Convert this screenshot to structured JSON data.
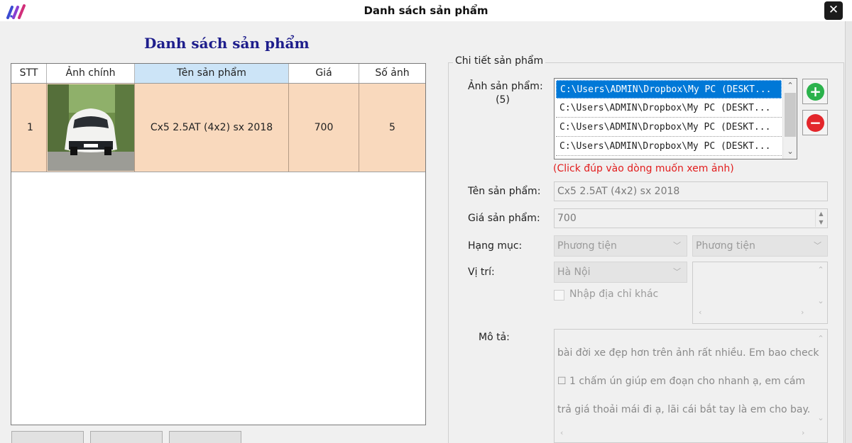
{
  "window": {
    "title": "Danh sách sản phẩm",
    "close_glyph": "✕",
    "logo_icon": "app-logo-icon"
  },
  "list": {
    "heading": "Danh sách sản phẩm",
    "columns": [
      "STT",
      "Ảnh chính",
      "Tên sản phẩm",
      "Giá",
      "Số ảnh"
    ],
    "selected_column": "Tên sản phẩm",
    "rows": [
      {
        "stt": "1",
        "image": "white-suv-photo",
        "name": "Cx5 2.5AT (4x2) sx 2018",
        "price": "700",
        "count": "5"
      }
    ]
  },
  "detail": {
    "group_title": "Chi tiết sản phẩm",
    "images_label": "Ảnh sản phẩm:",
    "images_count": "(5)",
    "images": [
      "C:\\Users\\ADMIN\\Dropbox\\My PC (DESKT...",
      "C:\\Users\\ADMIN\\Dropbox\\My PC (DESKT...",
      "C:\\Users\\ADMIN\\Dropbox\\My PC (DESKT...",
      "C:\\Users\\ADMIN\\Dropbox\\My PC (DESKT..."
    ],
    "add_glyph": "+",
    "remove_glyph": "−",
    "hint": "(Click đúp vào dòng muốn xem ảnh)",
    "name_label": "Tên sản phẩm:",
    "name_value": "Cx5 2.5AT (4x2) sx 2018",
    "price_label": "Giá sản phẩm:",
    "price_value": "700",
    "category_label": "Hạng mục:",
    "category_value": "Phương tiện",
    "subcategory_value": "Phương tiện",
    "location_label": "Vị trí:",
    "location_value": "Hà Nội",
    "other_address_label": "Nhập địa chỉ khác",
    "description_label": "Mô tả:",
    "description_lines": [
      "bài đời xe đẹp hơn trên ảnh rất nhiều. Em bao check",
      "☐ 1 chấm ún giúp em đoạn cho nhanh ạ, em cám",
      "trả giá thoải mái đi ạ, lãi cái bắt tay là em cho bay."
    ]
  },
  "colors": {
    "heading": "#1e1e8c",
    "row_selected": "#f9d9bd",
    "list_selected": "#0078d7",
    "hint": "#e21d1d",
    "add": "#2bb24c",
    "remove": "#e3262b"
  }
}
